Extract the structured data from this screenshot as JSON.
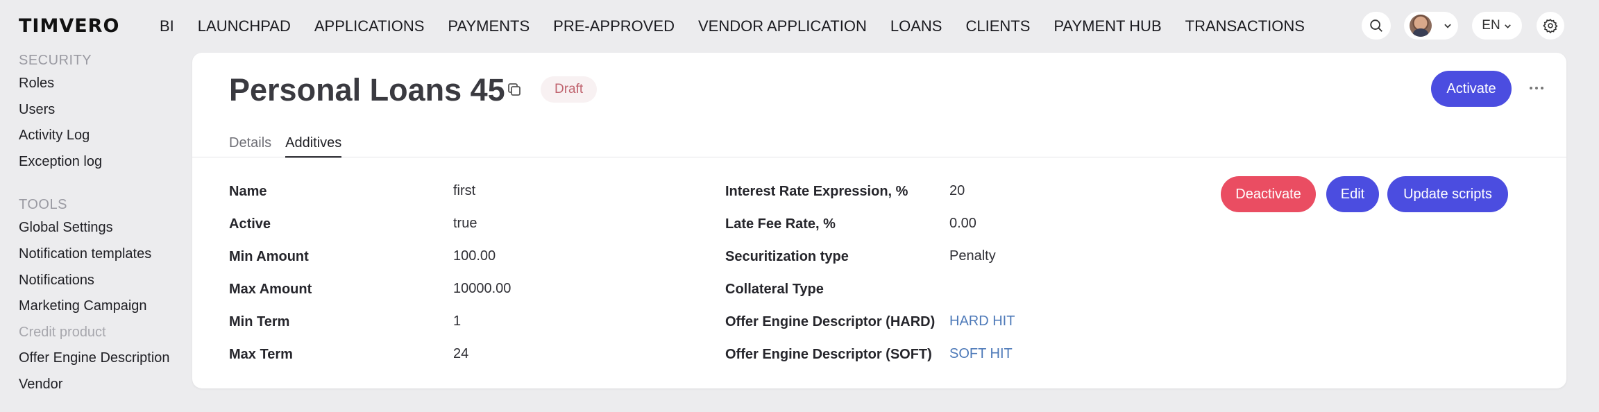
{
  "brand": {
    "logo_text": "TIMVERO"
  },
  "nav": {
    "items": [
      "BI",
      "LAUNCHPAD",
      "APPLICATIONS",
      "PAYMENTS",
      "PRE-APPROVED",
      "VENDOR APPLICATION",
      "LOANS",
      "CLIENTS",
      "PAYMENT HUB",
      "TRANSACTIONS"
    ]
  },
  "header": {
    "search_icon": "search-icon",
    "language": "EN",
    "settings_icon": "gear-icon"
  },
  "sidebar": {
    "security_title": "SECURITY",
    "security_items": [
      "Roles",
      "Users",
      "Activity Log",
      "Exception log"
    ],
    "tools_title": "TOOLS",
    "tools_items": [
      "Global Settings",
      "Notification templates",
      "Notifications",
      "Marketing Campaign",
      "Credit product",
      "Offer Engine Description",
      "Vendor"
    ]
  },
  "page": {
    "title": "Personal Loans 45",
    "status": "Draft",
    "activate_label": "Activate",
    "tabs": [
      "Details",
      "Additives"
    ],
    "active_tab": "Additives"
  },
  "details_left": [
    {
      "label": "Name",
      "value": "first"
    },
    {
      "label": "Active",
      "value": "true"
    },
    {
      "label": "Min Amount",
      "value": "100.00"
    },
    {
      "label": "Max Amount",
      "value": "10000.00"
    },
    {
      "label": "Min Term",
      "value": "1"
    },
    {
      "label": "Max Term",
      "value": "24"
    }
  ],
  "details_right": [
    {
      "label": "Interest Rate Expression, %",
      "value": "20"
    },
    {
      "label": "Late Fee Rate, %",
      "value": "0.00"
    },
    {
      "label": "Securitization type",
      "value": "Penalty"
    },
    {
      "label": "Collateral Type",
      "value": ""
    },
    {
      "label": "Offer Engine Descriptor (HARD)",
      "value": "HARD HIT"
    },
    {
      "label": "Offer Engine Descriptor (SOFT)",
      "value": "SOFT HIT"
    }
  ],
  "actions": {
    "deactivate_label": "Deactivate",
    "edit_label": "Edit",
    "update_scripts_label": "Update scripts"
  },
  "colors": {
    "primary": "#4b4de0",
    "danger": "#ea4d62",
    "link": "#4d79b8",
    "draft_text": "#c0646f",
    "draft_bg": "#f8f1f2"
  }
}
